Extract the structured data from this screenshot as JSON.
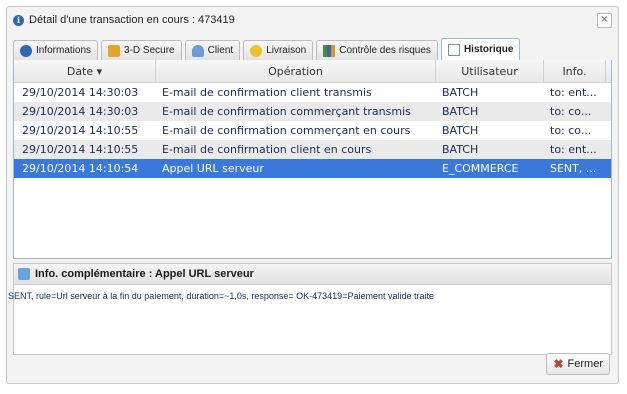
{
  "window": {
    "title": "Détail d'une transaction en cours : 473419",
    "close": "×"
  },
  "tabs": [
    {
      "label": "Informations",
      "icon": "info-icon"
    },
    {
      "label": "3-D Secure",
      "icon": "lock-icon"
    },
    {
      "label": "Client",
      "icon": "user-icon"
    },
    {
      "label": "Livraison",
      "icon": "delivery-icon"
    },
    {
      "label": "Contrôle des risques",
      "icon": "chart-icon"
    },
    {
      "label": "Historique",
      "icon": "document-icon",
      "active": true
    }
  ],
  "grid": {
    "columns": [
      "Date ▾",
      "Opération",
      "Utilisateur",
      "Info."
    ],
    "rows": [
      {
        "date": "29/10/2014 14:30:03",
        "op": "E-mail de confirmation client transmis",
        "user": "BATCH",
        "info": "to: ent..."
      },
      {
        "date": "29/10/2014 14:30:03",
        "op": "E-mail de confirmation commerçant transmis",
        "user": "BATCH",
        "info": "to: co..."
      },
      {
        "date": "29/10/2014 14:10:55",
        "op": "E-mail de confirmation commerçant en cours",
        "user": "BATCH",
        "info": "to: co..."
      },
      {
        "date": "29/10/2014 14:10:55",
        "op": "E-mail de confirmation client en cours",
        "user": "BATCH",
        "info": "to: ent..."
      },
      {
        "date": "29/10/2014 14:10:54",
        "op": "Appel URL serveur",
        "user": "E_COMMERCE",
        "info": "SENT, ..."
      }
    ]
  },
  "detail": {
    "title": "Info. complémentaire : Appel URL serveur",
    "text": "SENT, rule=Url serveur à la fin du paiement, duration=~1,0s, response= OK-473419=Paiement valide traite"
  },
  "footer": {
    "close_label": "Fermer"
  }
}
